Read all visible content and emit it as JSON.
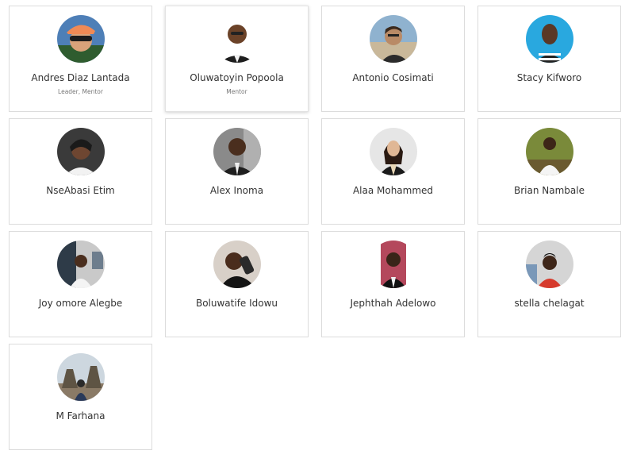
{
  "members": [
    {
      "name": "Andres Diaz Lantada",
      "role": "Leader, Mentor"
    },
    {
      "name": "Oluwatoyin Popoola",
      "role": "Mentor"
    },
    {
      "name": "Antonio Cosimati",
      "role": ""
    },
    {
      "name": "Stacy Kifworo",
      "role": ""
    },
    {
      "name": "NseAbasi Etim",
      "role": ""
    },
    {
      "name": "Alex Inoma",
      "role": ""
    },
    {
      "name": "Alaa Mohammed",
      "role": ""
    },
    {
      "name": "Brian Nambale",
      "role": ""
    },
    {
      "name": "Joy omore Alegbe",
      "role": ""
    },
    {
      "name": "Boluwatife Idowu",
      "role": ""
    },
    {
      "name": "Jephthah Adelowo",
      "role": ""
    },
    {
      "name": "stella chelagat",
      "role": ""
    },
    {
      "name": "M Farhana",
      "role": ""
    }
  ],
  "colors": {
    "card_border": "#dcdcdc",
    "name_text": "#333333",
    "role_text": "#777777"
  }
}
